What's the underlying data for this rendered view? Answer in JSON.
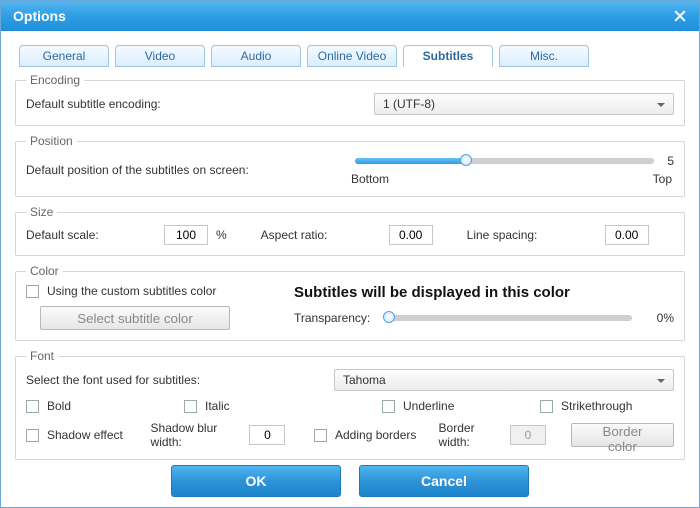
{
  "window": {
    "title": "Options"
  },
  "tabs": [
    "General",
    "Video",
    "Audio",
    "Online Video",
    "Subtitles",
    "Misc."
  ],
  "active_tab_index": 4,
  "encoding": {
    "legend": "Encoding",
    "label": "Default subtitle encoding:",
    "value": "1 (UTF-8)"
  },
  "position": {
    "legend": "Position",
    "label": "Default position of the subtitles on screen:",
    "value": "5",
    "min_label": "Bottom",
    "max_label": "Top",
    "fill_pct": 37
  },
  "size": {
    "legend": "Size",
    "scale_label": "Default scale:",
    "scale_value": "100",
    "scale_unit": "%",
    "aspect_label": "Aspect ratio:",
    "aspect_value": "0.00",
    "spacing_label": "Line spacing:",
    "spacing_value": "0.00"
  },
  "color": {
    "legend": "Color",
    "custom_label": "Using the custom subtitles color",
    "select_btn": "Select subtitle color",
    "preview_text": "Subtitles will be displayed in this color",
    "transparency_label": "Transparency:",
    "transparency_value": "0%",
    "transparency_fill_pct": 0
  },
  "font": {
    "legend": "Font",
    "select_label": "Select the font used for subtitles:",
    "value": "Tahoma",
    "bold": "Bold",
    "italic": "Italic",
    "underline": "Underline",
    "strike": "Strikethrough",
    "shadow": "Shadow effect",
    "shadow_width_label": "Shadow blur width:",
    "shadow_width_value": "0",
    "borders": "Adding borders",
    "border_width_label": "Border width:",
    "border_width_value": "0",
    "border_color_btn": "Border color"
  },
  "buttons": {
    "ok": "OK",
    "cancel": "Cancel"
  }
}
